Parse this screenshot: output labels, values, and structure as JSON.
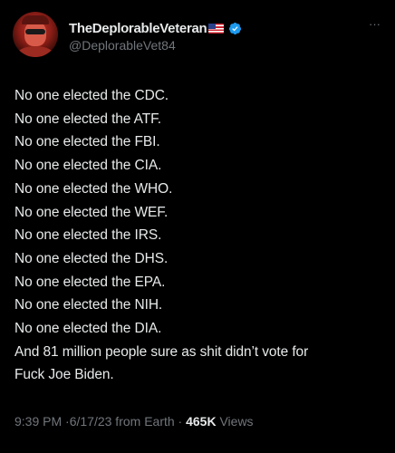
{
  "author": {
    "display_name": "TheDeplorableVeteran",
    "handle": "@DeplorableVet84",
    "flag_icon": "us-flag-icon",
    "verified_icon": "verified-badge-icon",
    "verified_color": "#1d9bf0",
    "more_label": "···"
  },
  "tweet": {
    "lines": [
      "No one elected the CDC.",
      "No one elected the ATF.",
      "No one elected the FBI.",
      "No one elected the CIA.",
      "No one elected the WHO.",
      "No one elected the WEF.",
      "No one elected the IRS.",
      "No one elected the DHS.",
      "No one elected the EPA.",
      "No one elected the NIH.",
      "No one elected the DIA.",
      "And 81 million people sure as shit didn’t vote for",
      "Fuck Joe Biden."
    ]
  },
  "meta": {
    "time": "9:39 PM",
    "separator": "·",
    "date": "6/17/23 from Earth",
    "views_count": "465K",
    "views_label": "Views"
  },
  "theme": {
    "background": "#000000",
    "text": "#e7e9ea",
    "muted": "#71767b"
  }
}
